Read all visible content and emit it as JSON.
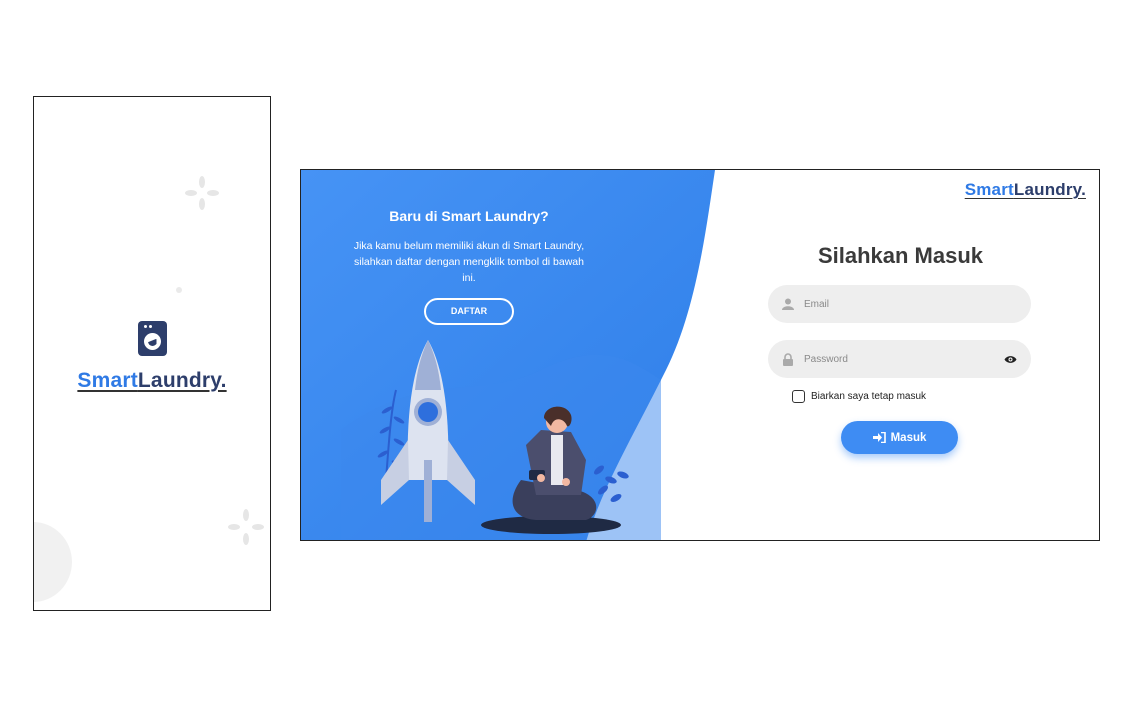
{
  "brand": {
    "part1": "Smart",
    "part2": "Laundry."
  },
  "colors": {
    "primary": "#3e8cf3",
    "primary_dark": "#2f7ae5",
    "navy": "#2d3e6b",
    "field_bg": "#eeeeee"
  },
  "promo": {
    "title": "Baru di Smart Laundry?",
    "text": "Jika kamu belum memiliki akun di Smart Laundry, silahkan daftar dengan mengklik tombol di bawah ini.",
    "button": "DAFTAR"
  },
  "login": {
    "title": "Silahkan Masuk",
    "email_placeholder": "Email",
    "password_placeholder": "Password",
    "remember_label": "Biarkan saya tetap masuk",
    "submit_label": "Masuk"
  },
  "icons": [
    "washing-machine-icon",
    "user-icon",
    "lock-icon",
    "eye-icon",
    "sign-in-icon"
  ]
}
